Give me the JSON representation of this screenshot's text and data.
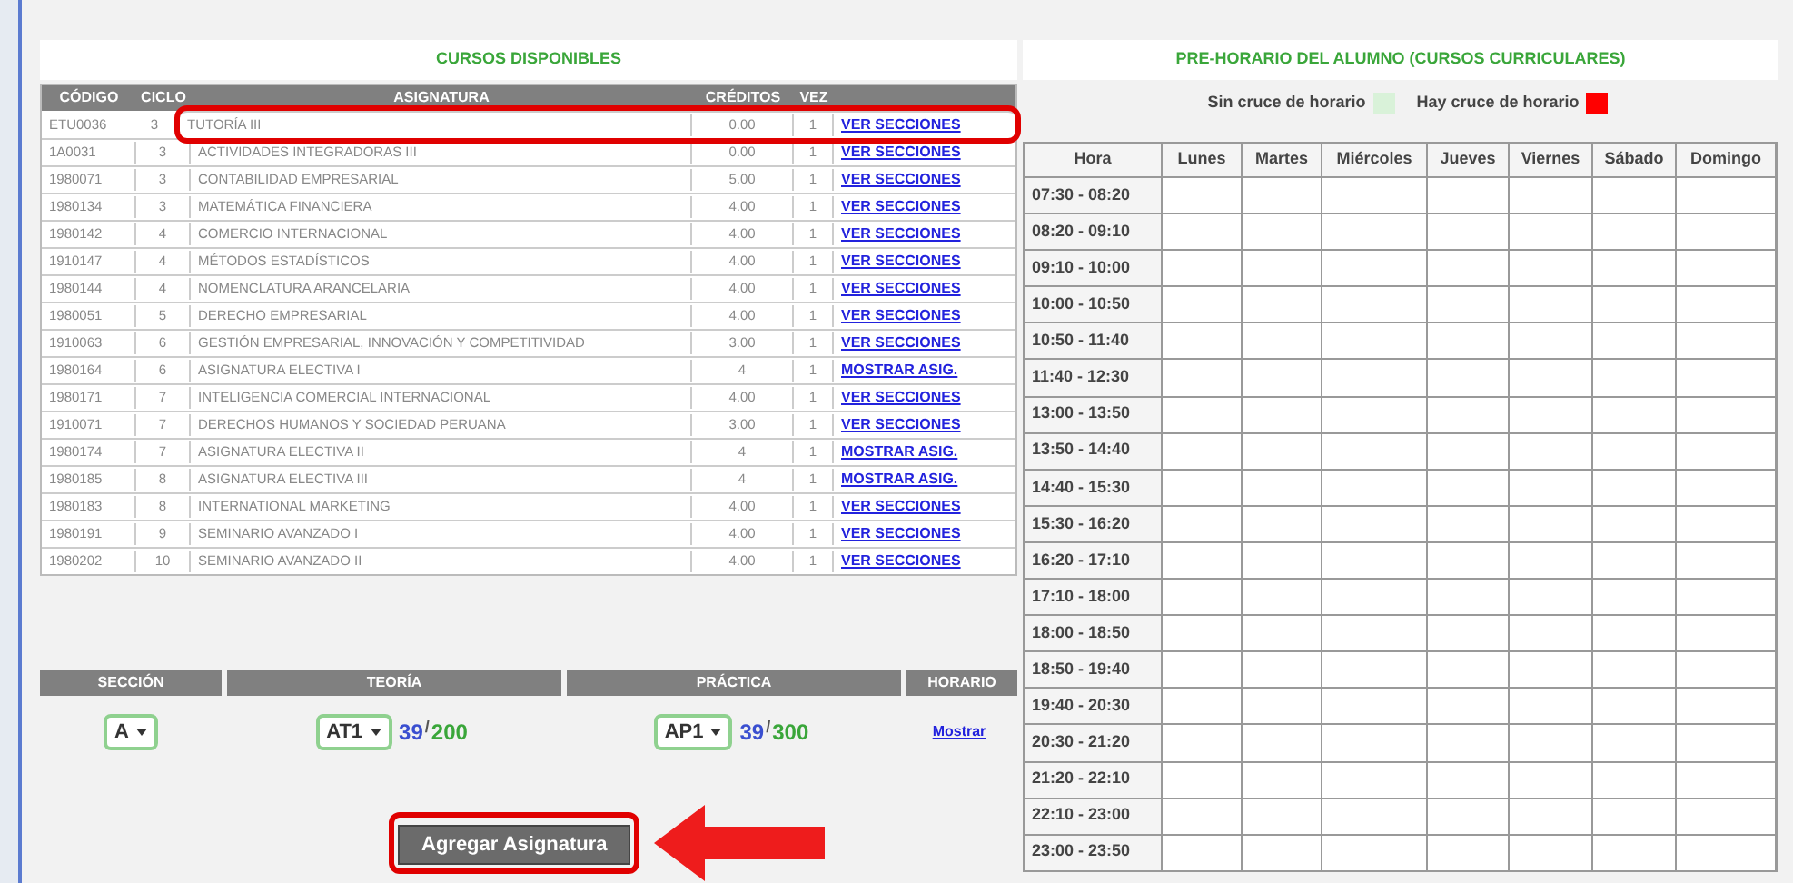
{
  "courses": {
    "title": "CURSOS DISPONIBLES",
    "columns": [
      "CÓDIGO",
      "CICLO",
      "ASIGNATURA",
      "CRÉDITOS",
      "VEZ"
    ],
    "rows": [
      {
        "code": "ETU0036",
        "cycle": "3",
        "subject": "TUTORÍA III",
        "credits": "0.00",
        "times": "1",
        "action": "VER SECCIONES",
        "highlighted": true
      },
      {
        "code": "1A0031",
        "cycle": "3",
        "subject": "ACTIVIDADES INTEGRADORAS III",
        "credits": "0.00",
        "times": "1",
        "action": "VER SECCIONES",
        "highlighted": false
      },
      {
        "code": "1980071",
        "cycle": "3",
        "subject": "CONTABILIDAD EMPRESARIAL",
        "credits": "5.00",
        "times": "1",
        "action": "VER SECCIONES",
        "highlighted": false
      },
      {
        "code": "1980134",
        "cycle": "3",
        "subject": "MATEMÁTICA FINANCIERA",
        "credits": "4.00",
        "times": "1",
        "action": "VER SECCIONES",
        "highlighted": false
      },
      {
        "code": "1980142",
        "cycle": "4",
        "subject": "COMERCIO INTERNACIONAL",
        "credits": "4.00",
        "times": "1",
        "action": "VER SECCIONES",
        "highlighted": false
      },
      {
        "code": "1910147",
        "cycle": "4",
        "subject": "MÉTODOS ESTADÍSTICOS",
        "credits": "4.00",
        "times": "1",
        "action": "VER SECCIONES",
        "highlighted": false
      },
      {
        "code": "1980144",
        "cycle": "4",
        "subject": "NOMENCLATURA ARANCELARIA",
        "credits": "4.00",
        "times": "1",
        "action": "VER SECCIONES",
        "highlighted": false
      },
      {
        "code": "1980051",
        "cycle": "5",
        "subject": "DERECHO EMPRESARIAL",
        "credits": "4.00",
        "times": "1",
        "action": "VER SECCIONES",
        "highlighted": false
      },
      {
        "code": "1910063",
        "cycle": "6",
        "subject": "GESTIÓN EMPRESARIAL, INNOVACIÓN Y COMPETITIVIDAD",
        "credits": "3.00",
        "times": "1",
        "action": "VER SECCIONES",
        "highlighted": false
      },
      {
        "code": "1980164",
        "cycle": "6",
        "subject": "ASIGNATURA ELECTIVA I",
        "credits": "4",
        "times": "1",
        "action": "MOSTRAR ASIG.",
        "highlighted": false
      },
      {
        "code": "1980171",
        "cycle": "7",
        "subject": "INTELIGENCIA COMERCIAL INTERNACIONAL",
        "credits": "4.00",
        "times": "1",
        "action": "VER SECCIONES",
        "highlighted": false
      },
      {
        "code": "1910071",
        "cycle": "7",
        "subject": "DERECHOS HUMANOS Y SOCIEDAD PERUANA",
        "credits": "3.00",
        "times": "1",
        "action": "VER SECCIONES",
        "highlighted": false
      },
      {
        "code": "1980174",
        "cycle": "7",
        "subject": "ASIGNATURA ELECTIVA II",
        "credits": "4",
        "times": "1",
        "action": "MOSTRAR ASIG.",
        "highlighted": false
      },
      {
        "code": "1980185",
        "cycle": "8",
        "subject": "ASIGNATURA ELECTIVA III",
        "credits": "4",
        "times": "1",
        "action": "MOSTRAR ASIG.",
        "highlighted": false
      },
      {
        "code": "1980183",
        "cycle": "8",
        "subject": "INTERNATIONAL MARKETING",
        "credits": "4.00",
        "times": "1",
        "action": "VER SECCIONES",
        "highlighted": false
      },
      {
        "code": "1980191",
        "cycle": "9",
        "subject": "SEMINARIO AVANZADO I",
        "credits": "4.00",
        "times": "1",
        "action": "VER SECCIONES",
        "highlighted": false
      },
      {
        "code": "1980202",
        "cycle": "10",
        "subject": "SEMINARIO AVANZADO II",
        "credits": "4.00",
        "times": "1",
        "action": "VER SECCIONES",
        "highlighted": false
      }
    ]
  },
  "selection": {
    "columns": [
      "SECCIÓN",
      "TEORÍA",
      "PRÁCTICA",
      "HORARIO"
    ],
    "section": "A",
    "theory": {
      "value": "AT1",
      "enrolled": "39",
      "separator": "/",
      "capacity": "200"
    },
    "practice": {
      "value": "AP1",
      "enrolled": "39",
      "separator": "/",
      "capacity": "300"
    },
    "schedule_link": "Mostrar"
  },
  "add_button": {
    "label": "Agregar Asignatura",
    "highlighted": true
  },
  "schedule": {
    "title": "PRE-HORARIO DEL ALUMNO (CURSOS CURRICULARES)",
    "legend": [
      {
        "label": "Sin cruce de horario",
        "color": "#d9f2d9"
      },
      {
        "label": "Hay cruce de horario",
        "color": "#ff0000"
      }
    ],
    "columns": [
      "Hora",
      "Lunes",
      "Martes",
      "Miércoles",
      "Jueves",
      "Viernes",
      "Sábado",
      "Domingo"
    ],
    "times": [
      "07:30 - 08:20",
      "08:20 - 09:10",
      "09:10 - 10:00",
      "10:00 - 10:50",
      "10:50 - 11:40",
      "11:40 - 12:30",
      "13:00 - 13:50",
      "13:50 - 14:40",
      "14:40 - 15:30",
      "15:30 - 16:20",
      "16:20 - 17:10",
      "17:10 - 18:00",
      "18:00 - 18:50",
      "18:50 - 19:40",
      "19:40 - 20:30",
      "20:30 - 21:20",
      "21:20 - 22:10",
      "22:10 - 23:00",
      "23:00 - 23:50"
    ]
  }
}
